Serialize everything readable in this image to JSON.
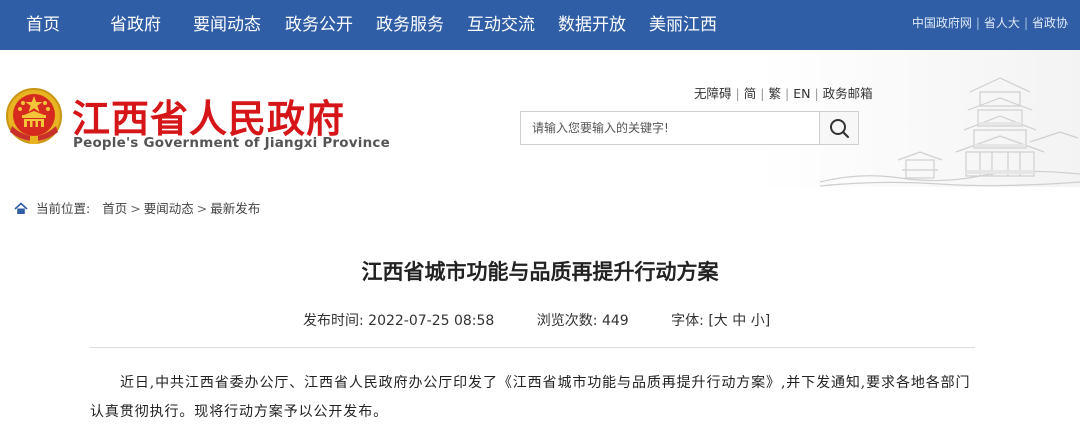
{
  "topnav": {
    "items": [
      "首页",
      "省政府",
      "要闻动态",
      "政务公开",
      "政务服务",
      "互动交流",
      "数据开放",
      "美丽江西"
    ],
    "bg_color": "#2f5ea6",
    "links": [
      "中国政府网",
      "省人大",
      "省政协"
    ]
  },
  "header": {
    "title": "江西省人民政府",
    "subtitle": "People's Government of Jiangxi Province",
    "title_color": "#d61518",
    "quick_links": [
      "无障碍",
      "简",
      "繁",
      "EN",
      "政务邮箱"
    ],
    "search": {
      "placeholder": "请输入您要输入的关键字!",
      "icon": "search-icon"
    }
  },
  "breadcrumb": {
    "label": "当前位置:",
    "items": [
      "首页",
      "要闻动态",
      "最新发布"
    ],
    "icon": "home-icon"
  },
  "article": {
    "title": "江西省城市功能与品质再提升行动方案",
    "meta": {
      "published_label": "发布时间:",
      "published_value": "2022-07-25 08:58",
      "views_label": "浏览次数:",
      "views_value": "449",
      "font_label": "字体:",
      "font_open": "[",
      "font_large": "大",
      "font_medium": "中",
      "font_small": "小",
      "font_close": "]"
    },
    "body": "近日,中共江西省委办公厅、江西省人民政府办公厅印发了《江西省城市功能与品质再提升行动方案》,并下发通知,要求各地各部门认真贯彻执行。现将行动方案予以公开发布。"
  }
}
